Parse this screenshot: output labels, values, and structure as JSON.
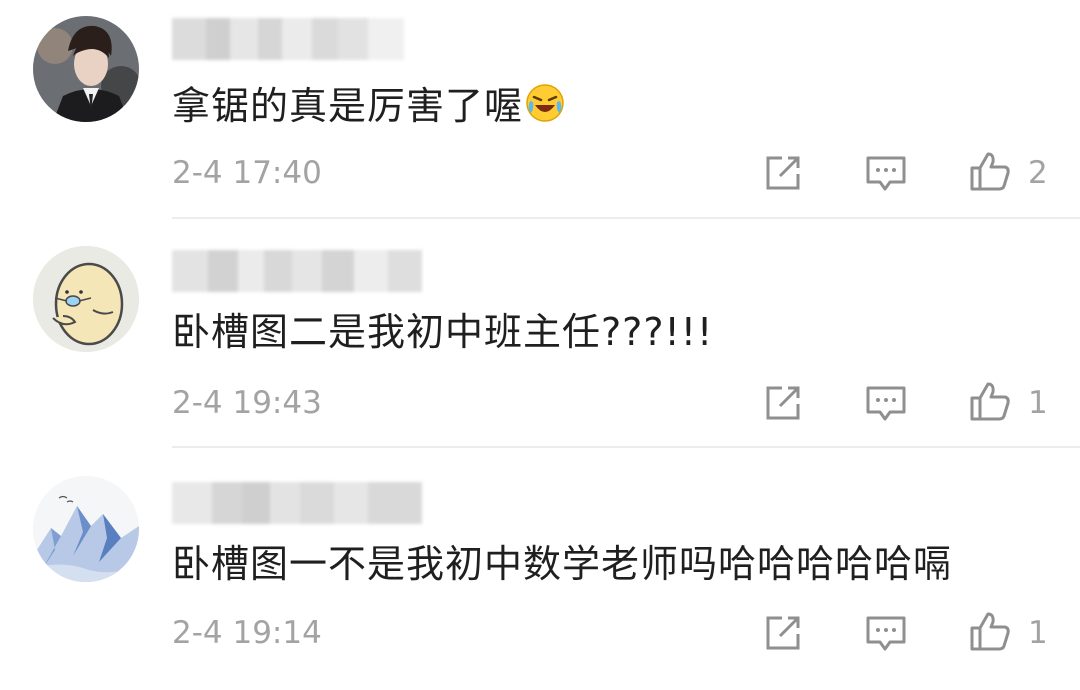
{
  "comments": [
    {
      "text": "拿锯的真是厉害了喔",
      "emoji": "laughing-crying-emoji",
      "time": "2-4 17:40",
      "likes": "2",
      "avatar": "young-man-photo-avatar"
    },
    {
      "text": "卧槽图二是我初中班主任???!!!",
      "time": "2-4 19:43",
      "likes": "1",
      "avatar": "cartoon-egg-face-avatar"
    },
    {
      "text": "卧槽图一不是我初中数学老师吗哈哈哈哈哈嗝",
      "time": "2-4 19:14",
      "likes": "1",
      "avatar": "blue-mountain-painting-avatar"
    }
  ],
  "icons": {
    "repost": "share-square-icon",
    "reply": "comment-bubble-icon",
    "like": "thumbs-up-icon"
  },
  "colors": {
    "text": "#1f1f1f",
    "meta": "#a3a3a3",
    "divider": "#ececec",
    "icon": "#8f8f8f"
  }
}
